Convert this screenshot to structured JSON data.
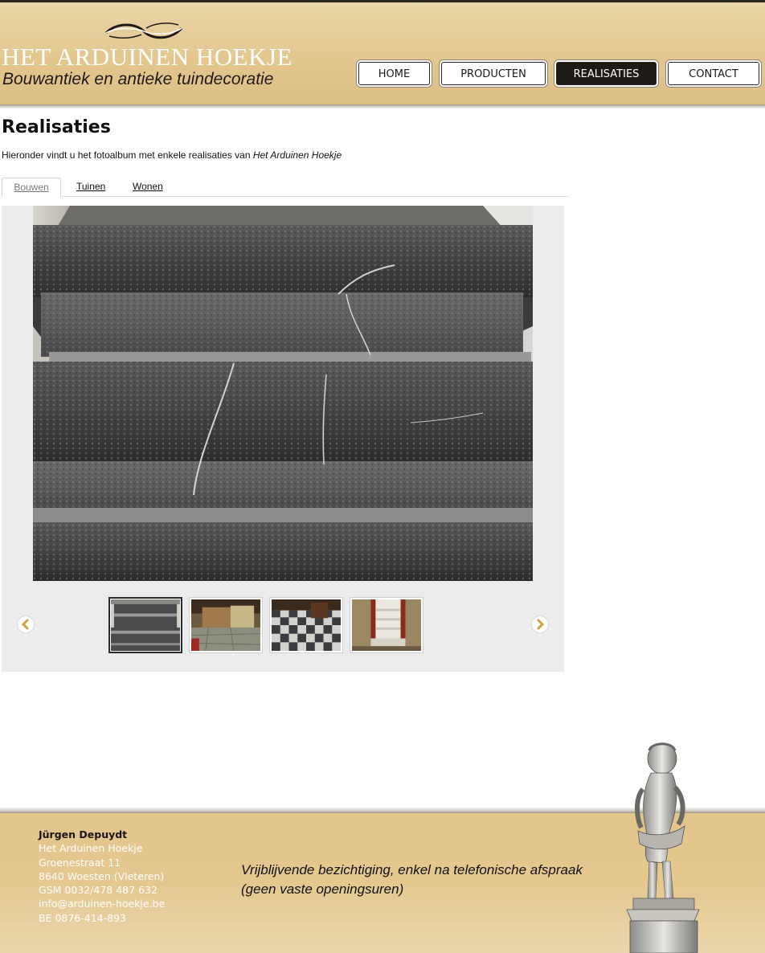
{
  "header": {
    "logo_title": "HET ARDUINEN HOEKJE",
    "logo_subtitle": "Bouwantiek en antieke tuindecoratie",
    "nav": [
      "HOME",
      "PRODUCTEN",
      "REALISATIES",
      "CONTACT"
    ],
    "active_nav": "REALISATIES"
  },
  "main": {
    "title": "Realisaties",
    "intro_text": "Hieronder vindt u het fotoalbum met enkele realisaties van ",
    "intro_emphasis": "Het Arduinen Hoekje",
    "tabs": [
      "Bouwen",
      "Tuinen",
      "Wonen"
    ],
    "active_tab": "Bouwen",
    "gallery": {
      "thumbnail_count": 4,
      "selected_index": 0,
      "prev_icon": "chevron-left-icon",
      "next_icon": "chevron-right-icon"
    }
  },
  "footer": {
    "contact_name": "Jürgen Depuydt",
    "contact_lines": [
      "Het Arduinen Hoekje",
      "Groenestraat 11",
      "8640 Woesten (Vleteren)",
      "GSM 0032/478 487 632",
      "info@arduinen-hoekje.be",
      "BE 0876-414-893"
    ],
    "notice_line1": "Vrijblijvende bezichtiging, enkel na telefonische afspraak",
    "notice_line2": "(geen vaste openingsuren)"
  },
  "colors": {
    "header_gold": "#e3c78f",
    "active_nav_bg": "#1e1a17",
    "gallery_bg": "#ececec",
    "arrow_accent": "#c9a24a"
  }
}
